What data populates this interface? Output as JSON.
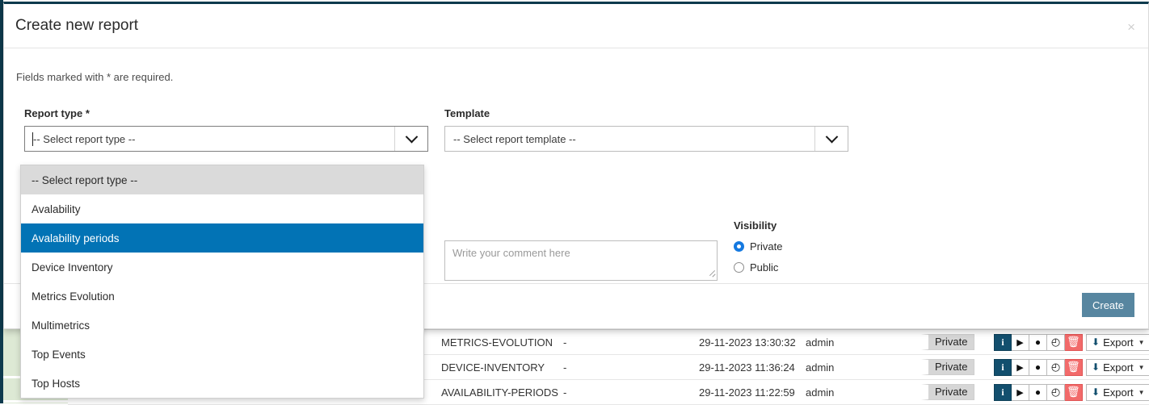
{
  "modal": {
    "title": "Create new report",
    "close_label": "×",
    "required_note": "Fields marked with * are required.",
    "report_type": {
      "label": "Report type *",
      "value": "-- Select report type --",
      "caret_icon": "chevron-down-icon"
    },
    "template": {
      "label": "Template",
      "value": "-- Select report template --",
      "caret_icon": "chevron-down-icon"
    },
    "comment": {
      "placeholder": "Write your comment here"
    },
    "visibility": {
      "label": "Visibility",
      "options": [
        {
          "label": "Private",
          "checked": true
        },
        {
          "label": "Public",
          "checked": false
        }
      ],
      "selected_color": "#1579e0"
    },
    "footer": {
      "create_label": "Create",
      "create_color": "#5786a0"
    }
  },
  "dropdown": {
    "options": [
      {
        "label": "-- Select report type --",
        "state": "placeholder"
      },
      {
        "label": "Avalability",
        "state": "normal"
      },
      {
        "label": "Avalability periods",
        "state": "selected"
      },
      {
        "label": "Device Inventory",
        "state": "normal"
      },
      {
        "label": "Metrics Evolution",
        "state": "normal"
      },
      {
        "label": "Multimetrics",
        "state": "normal"
      },
      {
        "label": "Top Events",
        "state": "normal"
      },
      {
        "label": "Top Hosts",
        "state": "normal"
      }
    ],
    "highlight_color": "#0273b5"
  },
  "background_table": {
    "rows": [
      {
        "type": "METRICS-EVOLUTION",
        "dash": "-",
        "date": "29-11-2023 13:30:32",
        "user": "admin",
        "visibility": "Private",
        "actions": [
          {
            "name": "info-button",
            "glyph": "i"
          },
          {
            "name": "run-button",
            "glyph": "▶"
          },
          {
            "name": "comment-button",
            "glyph": "💬"
          },
          {
            "name": "schedule-button",
            "glyph": "🕘"
          },
          {
            "name": "delete-button",
            "glyph": "🗑"
          }
        ],
        "export_label": "Export",
        "export_caret": "▼"
      },
      {
        "type": "DEVICE-INVENTORY",
        "dash": "-",
        "date": "29-11-2023 11:36:24",
        "user": "admin",
        "visibility": "Private",
        "actions": [
          {
            "name": "info-button",
            "glyph": "i"
          },
          {
            "name": "run-button",
            "glyph": "▶"
          },
          {
            "name": "comment-button",
            "glyph": "💬"
          },
          {
            "name": "schedule-button",
            "glyph": "🕘"
          },
          {
            "name": "delete-button",
            "glyph": "🗑"
          }
        ],
        "export_label": "Export",
        "export_caret": "▼"
      },
      {
        "type": "AVAILABILITY-PERIODS",
        "dash": "-",
        "date": "29-11-2023 11:22:59",
        "user": "admin",
        "visibility": "Private",
        "actions": [
          {
            "name": "info-button",
            "glyph": "i"
          },
          {
            "name": "run-button",
            "glyph": "▶"
          },
          {
            "name": "comment-button",
            "glyph": "💬"
          },
          {
            "name": "schedule-button",
            "glyph": "🕘"
          },
          {
            "name": "delete-button",
            "glyph": "🗑"
          }
        ],
        "export_label": "Export",
        "export_caret": "▼"
      }
    ],
    "info_button_color": "#124f6e",
    "delete_button_color": "#f26a6a"
  }
}
